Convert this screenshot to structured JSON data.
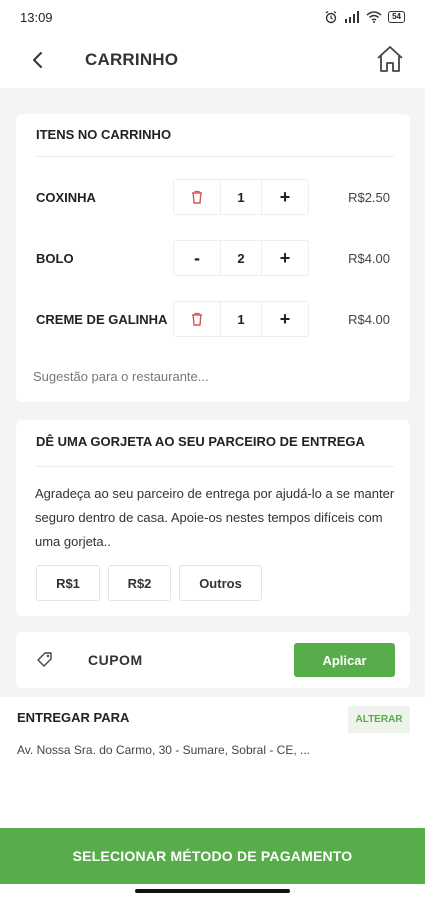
{
  "status_bar": {
    "time": "13:09",
    "battery": "54",
    "icons": [
      "alarm-icon",
      "signal-icon",
      "wifi-icon",
      "battery-icon"
    ]
  },
  "header": {
    "title": "CARRINHO",
    "back_icon": "chevron-left-icon",
    "home_icon": "home-icon"
  },
  "cart": {
    "title": "ITENS NO CARRINHO",
    "items": [
      {
        "name": "COXINHA",
        "minus": "trash-icon",
        "qty": "1",
        "plus": "+",
        "price": "R$2.50"
      },
      {
        "name": "BOLO",
        "minus": "-",
        "qty": "2",
        "plus": "+",
        "price": "R$4.00"
      },
      {
        "name": "CREME DE GALINHA",
        "minus": "trash-icon",
        "qty": "1",
        "plus": "+",
        "price": "R$4.00"
      }
    ],
    "suggestion_placeholder": "Sugestão para o restaurante..."
  },
  "tip": {
    "title": "DÊ UMA GORJETA AO SEU PARCEIRO DE ENTREGA",
    "text": "Agradeça ao seu parceiro de entrega por ajudá-lo a se manter seguro dentro de casa. Apoie-os nestes tempos difíceis com uma gorjeta..",
    "options": [
      "R$1",
      "R$2",
      "Outros"
    ]
  },
  "coupon": {
    "icon": "tag-icon",
    "label": "CUPOM",
    "apply_label": "Aplicar"
  },
  "delivery": {
    "title": "ENTREGAR PARA",
    "change_label": "ALTERAR",
    "address": "Av. Nossa Sra. do Carmo, 30 - Sumare, Sobral - CE, ..."
  },
  "footer": {
    "pay_label": "SELECIONAR MÉTODO DE PAGAMENTO"
  },
  "colors": {
    "accent": "#57ad49",
    "trash": "#d9534f",
    "background": "#f4f4f4"
  }
}
